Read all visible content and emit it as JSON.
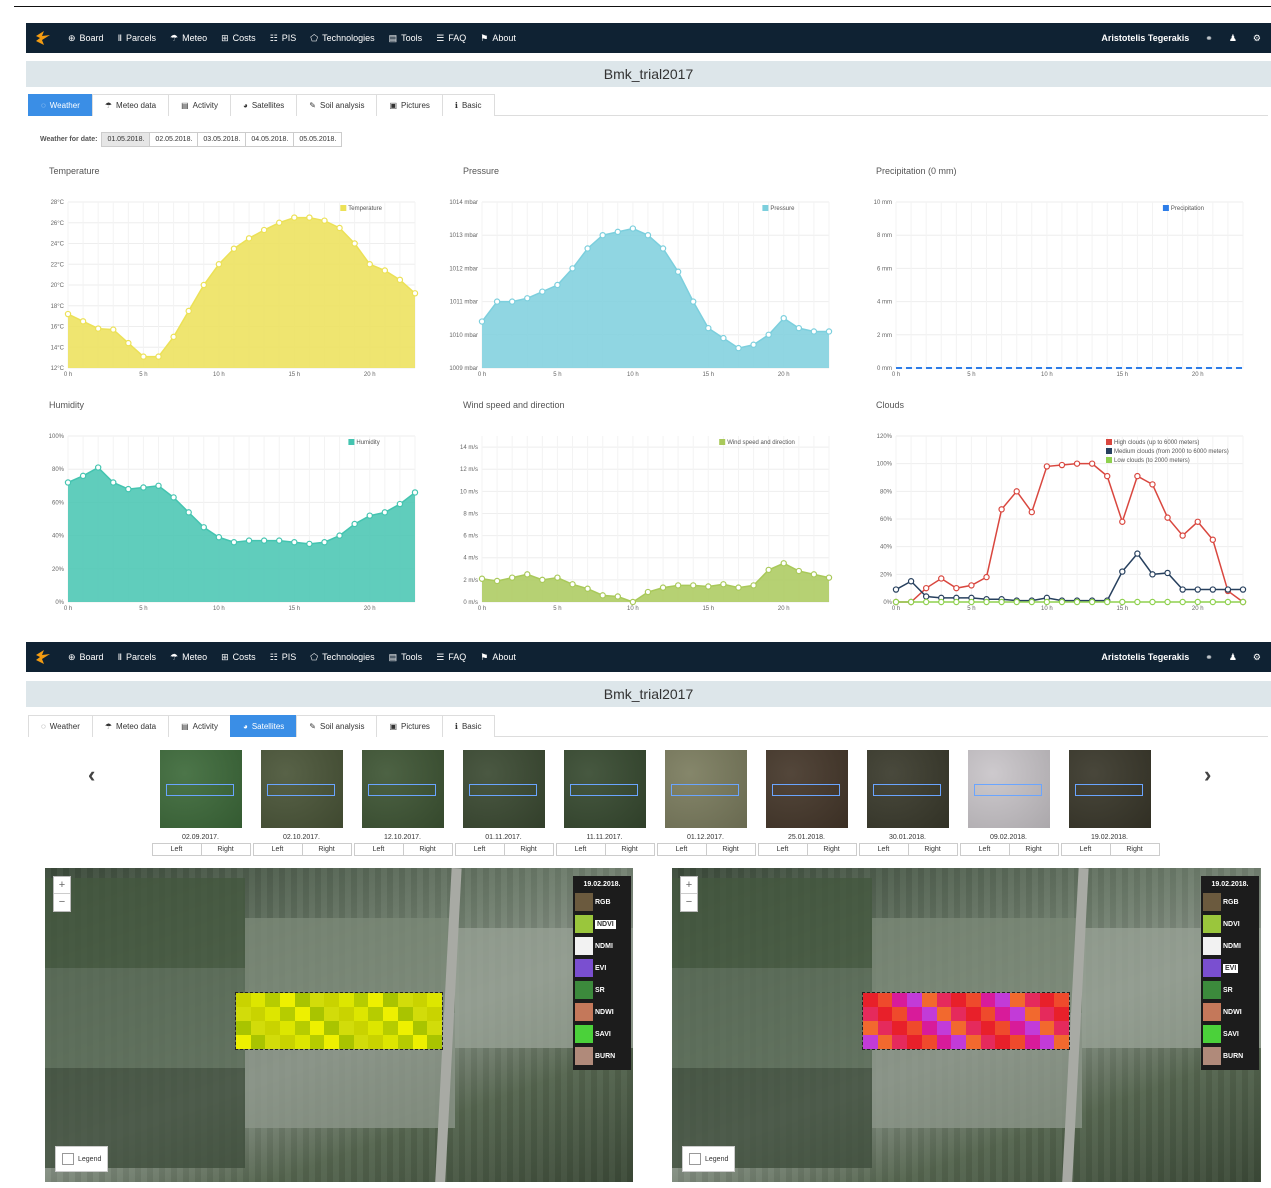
{
  "nav": {
    "items": [
      {
        "label": "Board",
        "icon": "globe-icon"
      },
      {
        "label": "Parcels",
        "icon": "columns-icon"
      },
      {
        "label": "Meteo",
        "icon": "umbrella-icon"
      },
      {
        "label": "Costs",
        "icon": "table-icon"
      },
      {
        "label": "PIS",
        "icon": "grid-icon"
      },
      {
        "label": "Technologies",
        "icon": "tag-icon"
      },
      {
        "label": "Tools",
        "icon": "toolbox-icon"
      },
      {
        "label": "FAQ",
        "icon": "list-icon"
      },
      {
        "label": "About",
        "icon": "pin-icon"
      }
    ],
    "user": "Aristotelis Tegerakis"
  },
  "page_title": "Bmk_trial2017",
  "tabs": [
    "Weather",
    "Meteo data",
    "Activity",
    "Satellites",
    "Soil analysis",
    "Pictures",
    "Basic"
  ],
  "weather": {
    "date_label": "Weather for date:",
    "dates": [
      "01.05.2018.",
      "02.05.2018.",
      "03.05.2018.",
      "04.05.2018.",
      "05.05.2018."
    ]
  },
  "chart_data": [
    {
      "type": "area",
      "title": "Temperature",
      "legend": [
        "Temperature"
      ],
      "color": "#ece157",
      "unit": "°C",
      "x": [
        0,
        1,
        2,
        3,
        4,
        5,
        6,
        7,
        8,
        9,
        10,
        11,
        12,
        13,
        14,
        15,
        16,
        17,
        18,
        19,
        20,
        21,
        22,
        23
      ],
      "values": [
        17.2,
        16.5,
        15.8,
        15.7,
        14.4,
        13.1,
        13.1,
        15.0,
        17.5,
        20.0,
        22.0,
        23.5,
        24.5,
        25.3,
        26.0,
        26.5,
        26.5,
        26.2,
        25.5,
        24.0,
        22.0,
        21.4,
        20.5,
        19.2
      ],
      "ylim": [
        12,
        28
      ],
      "yticks": [
        12,
        14,
        16,
        18,
        20,
        22,
        24,
        26,
        28
      ],
      "xticks": [
        0,
        5,
        10,
        15,
        20
      ],
      "xtick_labels": [
        "0 h",
        "5 h",
        "10 h",
        "15 h",
        "20 h"
      ]
    },
    {
      "type": "area",
      "title": "Pressure",
      "legend": [
        "Pressure"
      ],
      "color": "#7ccfdd",
      "unit": "mbar",
      "x": [
        0,
        1,
        2,
        3,
        4,
        5,
        6,
        7,
        8,
        9,
        10,
        11,
        12,
        13,
        14,
        15,
        16,
        17,
        18,
        19,
        20,
        21,
        22,
        23
      ],
      "values": [
        1010.4,
        1011.0,
        1011.0,
        1011.1,
        1011.3,
        1011.5,
        1012.0,
        1012.6,
        1013.0,
        1013.1,
        1013.2,
        1013.0,
        1012.6,
        1011.9,
        1011.0,
        1010.2,
        1009.9,
        1009.6,
        1009.7,
        1010.0,
        1010.5,
        1010.2,
        1010.1,
        1010.1
      ],
      "ylim": [
        1009,
        1014
      ],
      "yticks": [
        1009,
        1010,
        1011,
        1012,
        1013,
        1014
      ],
      "xticks": [
        0,
        5,
        10,
        15,
        20
      ],
      "xtick_labels": [
        "0 h",
        "5 h",
        "10 h",
        "15 h",
        "20 h"
      ]
    },
    {
      "type": "line",
      "title": "Precipitation (0 mm)",
      "legend": [
        "Precipitation"
      ],
      "color": "#2d7de8",
      "unit": "mm",
      "x": [
        0,
        23
      ],
      "values": [
        0,
        0
      ],
      "ylim": [
        0,
        10
      ],
      "yticks": [
        0,
        2,
        4,
        6,
        8,
        10
      ],
      "xticks": [
        0,
        5,
        10,
        15,
        20
      ],
      "xtick_labels": [
        "0 h",
        "5 h",
        "10 h",
        "15 h",
        "20 h"
      ]
    },
    {
      "type": "area",
      "title": "Humidity",
      "legend": [
        "Humidity"
      ],
      "color": "#44c4b0",
      "unit": "%",
      "x": [
        0,
        1,
        2,
        3,
        4,
        5,
        6,
        7,
        8,
        9,
        10,
        11,
        12,
        13,
        14,
        15,
        16,
        17,
        18,
        19,
        20,
        21,
        22,
        23
      ],
      "values": [
        72,
        76,
        81,
        72,
        68,
        69,
        70,
        63,
        54,
        45,
        39,
        36,
        37,
        37,
        37,
        36,
        35,
        36,
        40,
        47,
        52,
        54,
        59,
        66
      ],
      "ylim": [
        0,
        100
      ],
      "yticks": [
        0,
        20,
        40,
        60,
        80,
        100
      ],
      "xticks": [
        0,
        5,
        10,
        15,
        20
      ],
      "xtick_labels": [
        "0 h",
        "5 h",
        "10 h",
        "15 h",
        "20 h"
      ]
    },
    {
      "type": "area",
      "title": "Wind speed and direction",
      "legend": [
        "Wind speed and direction"
      ],
      "color": "#a9c95a",
      "unit": "m/s",
      "x": [
        0,
        1,
        2,
        3,
        4,
        5,
        6,
        7,
        8,
        9,
        10,
        11,
        12,
        13,
        14,
        15,
        16,
        17,
        18,
        19,
        20,
        21,
        22,
        23
      ],
      "values": [
        2.1,
        1.9,
        2.2,
        2.5,
        2.0,
        2.2,
        1.6,
        1.2,
        0.6,
        0.5,
        0.0,
        0.9,
        1.3,
        1.5,
        1.5,
        1.4,
        1.6,
        1.3,
        1.5,
        2.9,
        3.5,
        2.8,
        2.5,
        2.2
      ],
      "ylim": [
        0,
        15
      ],
      "yticks": [
        0,
        2,
        4,
        6,
        8,
        10,
        12,
        14
      ],
      "xticks": [
        0,
        5,
        10,
        15,
        20
      ],
      "xtick_labels": [
        "0 h",
        "5 h",
        "10 h",
        "15 h",
        "20 h"
      ]
    },
    {
      "type": "line",
      "title": "Clouds",
      "unit": "%",
      "x": [
        0,
        1,
        2,
        3,
        4,
        5,
        6,
        7,
        8,
        9,
        10,
        11,
        12,
        13,
        14,
        15,
        16,
        17,
        18,
        19,
        20,
        21,
        22,
        23
      ],
      "series": [
        {
          "name": "High clouds (up to 6000 meters)",
          "color": "#d9473f",
          "values": [
            0,
            0,
            10,
            17,
            10,
            12,
            18,
            67,
            80,
            65,
            98,
            99,
            100,
            100,
            91,
            58,
            91,
            85,
            61,
            48,
            58,
            45,
            8,
            0
          ]
        },
        {
          "name": "Medium clouds (from 2000 to 6000 meters)",
          "color": "#27405e",
          "values": [
            9,
            15,
            4,
            3,
            3,
            3,
            2,
            2,
            1,
            1,
            3,
            1,
            1,
            1,
            1,
            22,
            35,
            20,
            21,
            9,
            9,
            9,
            9,
            9
          ]
        },
        {
          "name": "Low clouds (to 2000 meters)",
          "color": "#8fd14f",
          "values": [
            0,
            0,
            0,
            0,
            0,
            0,
            0,
            0,
            0,
            0,
            0,
            0,
            0,
            0,
            0,
            0,
            0,
            0,
            0,
            0,
            0,
            0,
            0,
            0
          ]
        }
      ],
      "ylim": [
        0,
        120
      ],
      "yticks": [
        0,
        20,
        40,
        60,
        80,
        100,
        120
      ],
      "xticks": [
        0,
        5,
        10,
        15,
        20
      ],
      "xtick_labels": [
        "0 h",
        "5 h",
        "10 h",
        "15 h",
        "20 h"
      ]
    }
  ],
  "satellite": {
    "thumbnails": [
      {
        "date": "02.09.2017.",
        "color": "#3d6a3a"
      },
      {
        "date": "02.10.2017.",
        "color": "#4a5538"
      },
      {
        "date": "12.10.2017.",
        "color": "#3e5534"
      },
      {
        "date": "01.11.2017.",
        "color": "#3b4a32"
      },
      {
        "date": "11.11.2017.",
        "color": "#374a30"
      },
      {
        "date": "01.12.2017.",
        "color": "#7b7c5e"
      },
      {
        "date": "25.01.2018.",
        "color": "#45372a"
      },
      {
        "date": "30.01.2018.",
        "color": "#3a3a2c"
      },
      {
        "date": "09.02.2018.",
        "color": "#c9c5c9"
      },
      {
        "date": "19.02.2018.",
        "color": "#39372a"
      }
    ],
    "left_label": "Left",
    "right_label": "Right",
    "maps": [
      {
        "date": "19.02.2018.",
        "selected": "NDVI"
      },
      {
        "date": "19.02.2018.",
        "selected": "EVI"
      }
    ],
    "layers": [
      {
        "name": "RGB",
        "color": "#6b5a3e"
      },
      {
        "name": "NDVI",
        "color": "#9ac63c"
      },
      {
        "name": "NDMI",
        "color": "#f2f2f2"
      },
      {
        "name": "EVI",
        "color": "#7a4fd0"
      },
      {
        "name": "SR",
        "color": "#3c8a3c"
      },
      {
        "name": "NDWI",
        "color": "#c4785a"
      },
      {
        "name": "SAVI",
        "color": "#4bd13a"
      },
      {
        "name": "BURN",
        "color": "#b08a7a"
      }
    ],
    "zoom_in": "+",
    "zoom_out": "−",
    "legend_label": "Legend"
  }
}
